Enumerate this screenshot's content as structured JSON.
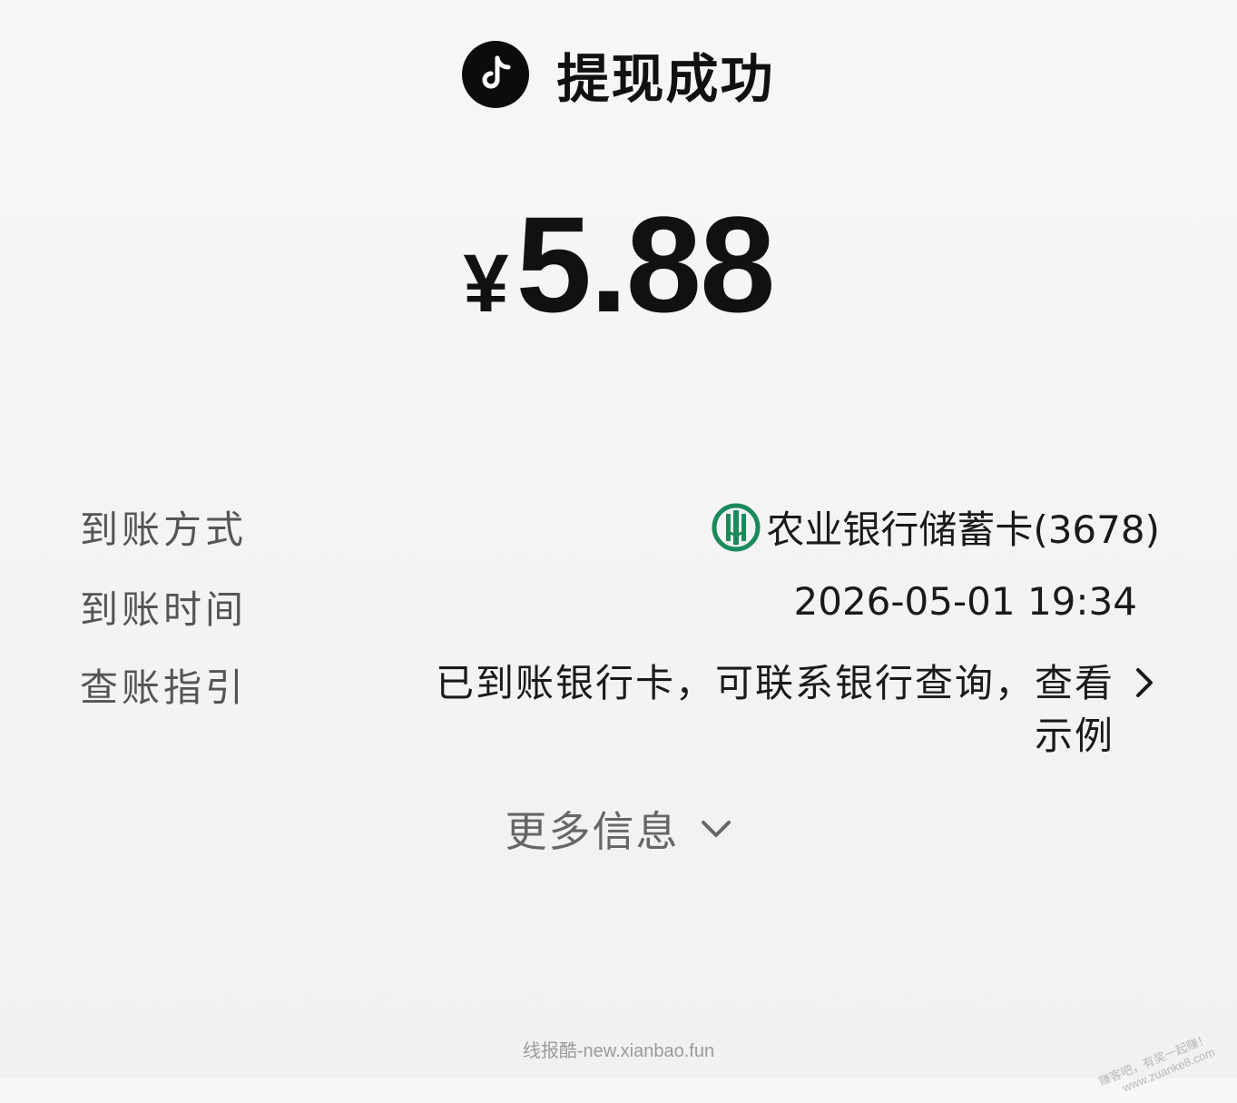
{
  "header": {
    "app_icon": "tiktok-note-icon",
    "title": "提现成功"
  },
  "amount": {
    "currency": "¥",
    "value": "5.88"
  },
  "details": {
    "method": {
      "label": "到账方式",
      "bank_icon": "agricultural-bank-logo-icon",
      "value": "农业银行储蓄卡(3678)"
    },
    "time": {
      "label": "到账时间",
      "value": "2026-05-01 19:34"
    },
    "guide": {
      "label": "查账指引",
      "value": "已到账银行卡，可联系银行查询，查看示例"
    }
  },
  "more_info": {
    "label": "更多信息"
  },
  "watermarks": {
    "footer": "线报酷-new.xianbao.fun",
    "corner_line1": "赚客吧，有奖一起赚！",
    "corner_line2": "www.zuanke8.com"
  },
  "colors": {
    "bank_green": "#1a8a5a",
    "label_gray": "#555555",
    "text_dark": "#111111"
  }
}
